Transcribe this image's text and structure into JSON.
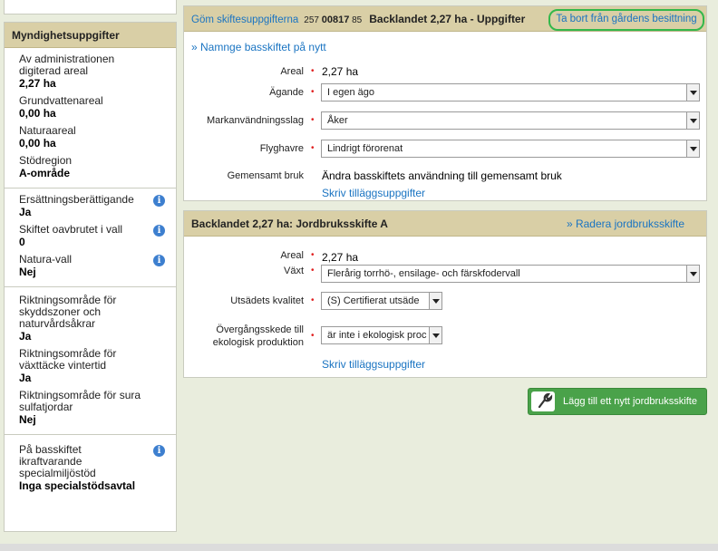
{
  "sidebar": {
    "title": "Myndighetsuppgifter",
    "group1": [
      {
        "label": "Av administrationen digiterad areal",
        "value": "2,27 ha"
      },
      {
        "label": "Grundvattenareal",
        "value": "0,00 ha"
      },
      {
        "label": "Naturaareal",
        "value": "0,00 ha"
      },
      {
        "label": "Stödregion",
        "value": "A-område"
      }
    ],
    "group2": [
      {
        "label": "Ersättningsberättigande",
        "value": "Ja"
      },
      {
        "label": "Skiftet oavbrutet i vall",
        "value": "0"
      },
      {
        "label": "Natura-vall",
        "value": "Nej"
      }
    ],
    "group3": [
      {
        "label": "Riktningsområde för skyddszoner och naturvårdsåkrar",
        "value": "Ja"
      },
      {
        "label": "Riktningsområde för växttäcke vintertid",
        "value": "Ja"
      },
      {
        "label": "Riktningsområde för sura sulfatjordar",
        "value": "Nej"
      }
    ],
    "group4": [
      {
        "label": "På basskiftet ikraftvarande specialmiljöstöd",
        "value": "Inga specialstödsavtal"
      }
    ]
  },
  "basic_parcel": {
    "hide_link": "Göm skiftesuppgifterna",
    "parcel_prefix": "257",
    "parcel_main": "00817",
    "parcel_suffix": "85",
    "title": "Backlandet 2,27 ha - Uppgifter",
    "remove_link": "Ta bort från gårdens besittning",
    "rename_link": "» Namnge basskiftet på nytt",
    "fields": {
      "area_label": "Areal",
      "area_value": "2,27 ha",
      "ownership_label": "Ägande",
      "ownership_value": "I egen ägo",
      "landuse_label": "Markanvändningsslag",
      "landuse_value": "Åker",
      "oat_label": "Flyghavre",
      "oat_value": "Lindrigt förorenat",
      "shared_label": "Gemensamt bruk",
      "shared_link": "Ändra basskiftets användning till gemensamt bruk"
    },
    "extra_link": "Skriv tilläggsuppgifter"
  },
  "agri_parcel": {
    "title": "Backlandet 2,27 ha: Jordbruksskifte A",
    "delete_link": "» Radera jordbruksskifte",
    "fields": {
      "area_label": "Areal",
      "area_value": "2,27  ha",
      "crop_label": "Växt",
      "crop_value": "Flerårig torrhö-, ensilage- och färskfodervall",
      "seed_label": "Utsädets kvalitet",
      "seed_value": "(S) Certifierat utsäde",
      "transition_label_1": "Övergångsskede till",
      "transition_label_2": "ekologisk produktion",
      "transition_value": "är inte i ekologisk proc"
    },
    "extra_link": "Skriv tilläggsuppgifter"
  },
  "add_button": {
    "label": "Lägg till ett nytt jordbruksskifte",
    "icon": "wrench-icon"
  },
  "colors": {
    "header_bg": "#d9cfa6",
    "link": "#1a74c2",
    "highlight": "#33b84b",
    "button": "#4aa24a",
    "required": "#e02020"
  }
}
